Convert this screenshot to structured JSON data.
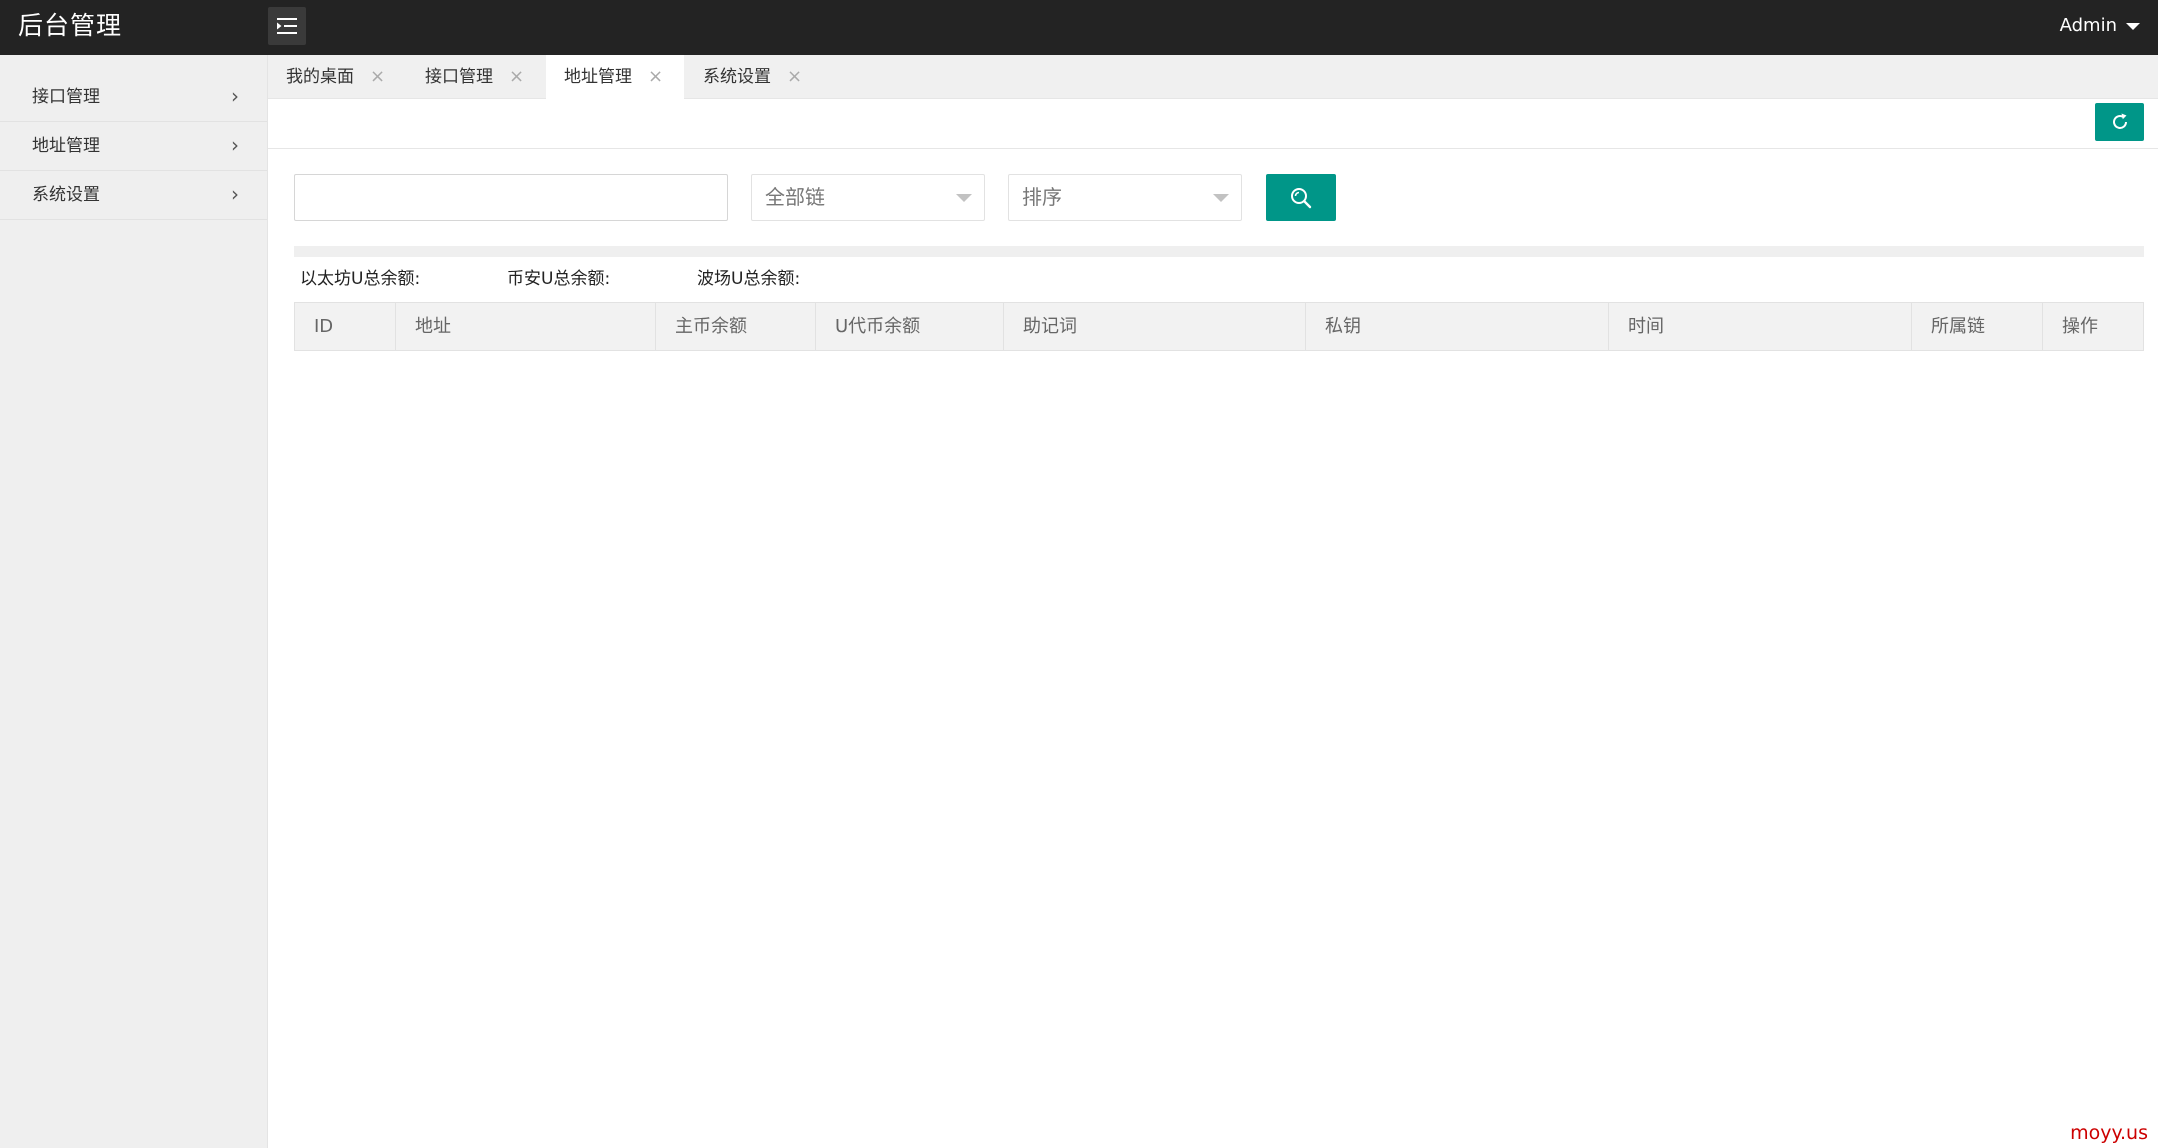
{
  "app": {
    "title": "后台管理",
    "user": "Admin"
  },
  "sidebar": {
    "items": [
      {
        "label": "接口管理"
      },
      {
        "label": "地址管理"
      },
      {
        "label": "系统设置"
      }
    ]
  },
  "tabs": [
    {
      "label": "我的桌面",
      "active": false
    },
    {
      "label": "接口管理",
      "active": false
    },
    {
      "label": "地址管理",
      "active": true
    },
    {
      "label": "系统设置",
      "active": false
    }
  ],
  "filters": {
    "search_value": "",
    "chain_select": "全部链",
    "sort_select": "排序"
  },
  "totals": {
    "eth": "以太坊U总余额:",
    "bsc": "币安U总余额:",
    "tron": "波场U总余额:"
  },
  "table": {
    "columns": [
      "ID",
      "地址",
      "主币余额",
      "U代币余额",
      "助记词",
      "私钥",
      "时间",
      "所属链",
      "操作"
    ],
    "rows": []
  },
  "footer": {
    "watermark": "moyy.us"
  },
  "colors": {
    "topbar": "#232323",
    "accent": "#009688",
    "sidebar": "#efefef",
    "watermark": "#cc0000"
  },
  "icons": {
    "menu_toggle": "indent-menu-icon",
    "refresh": "refresh-icon",
    "search": "search-icon",
    "chevron": "chevron-right-icon",
    "close": "close-icon"
  }
}
